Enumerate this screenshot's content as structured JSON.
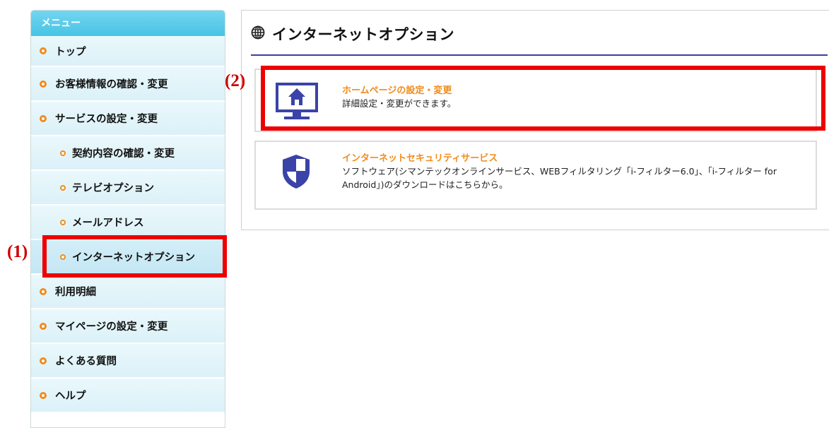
{
  "sidebar": {
    "header": "メニュー",
    "items": [
      {
        "label": "トップ"
      },
      {
        "label": "お客様情報の確認・変更"
      },
      {
        "label": "サービスの設定・変更"
      },
      {
        "label": "契約内容の確認・変更"
      },
      {
        "label": "テレビオプション"
      },
      {
        "label": "メールアドレス"
      },
      {
        "label": "インターネットオプション"
      },
      {
        "label": "利用明細"
      },
      {
        "label": "マイページの設定・変更"
      },
      {
        "label": "よくある質問"
      },
      {
        "label": "ヘルプ"
      }
    ],
    "selected": "インターネットオプション"
  },
  "main": {
    "title": "インターネットオプション",
    "title_icon": "globe-icon",
    "cards": [
      {
        "title": "ホームページの設定・変更",
        "description": "詳細設定・変更ができます。",
        "icon": "homepage-monitor-icon"
      },
      {
        "title": "インターネットセキュリティサービス",
        "description": "ソフトウェア(シマンテックオンラインサービス、WEBフィルタリング「i-フィルター6.0」、「i-フィルター for Android」)のダウンロードはこちらから。",
        "icon": "security-shield-icon"
      }
    ]
  },
  "annotations": {
    "step1": "(1)",
    "step2": "(2)",
    "highlight_color": "#ee0000"
  },
  "colors": {
    "accent_orange": "#f08c1c",
    "menu_header": "#48c3e4",
    "title_underline": "#3a3fa6",
    "icon_blue": "#3a43a8"
  }
}
